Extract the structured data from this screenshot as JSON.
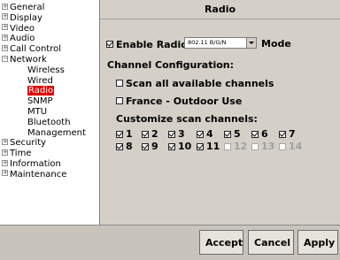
{
  "tree": {
    "items": [
      {
        "label": "General",
        "expander": "+"
      },
      {
        "label": "Display",
        "expander": "+"
      },
      {
        "label": "Video",
        "expander": "+"
      },
      {
        "label": "Audio",
        "expander": "+"
      },
      {
        "label": "Call Control",
        "expander": "+"
      },
      {
        "label": "Network",
        "expander": "−"
      },
      {
        "label": "Wireless"
      },
      {
        "label": "Wired"
      },
      {
        "label": "Radio",
        "selected": true
      },
      {
        "label": "SNMP"
      },
      {
        "label": "MTU"
      },
      {
        "label": "Bluetooth"
      },
      {
        "label": "Management"
      },
      {
        "label": "Security",
        "expander": "+"
      },
      {
        "label": "Time",
        "expander": "+"
      },
      {
        "label": "Information",
        "expander": "+"
      },
      {
        "label": "Maintenance",
        "expander": "+"
      }
    ]
  },
  "panel": {
    "title": "Radio",
    "enable_radio": {
      "label": "Enable Radio",
      "checked": true
    },
    "mode": {
      "selected": "802.11 B/G/N",
      "label": "Mode"
    },
    "channel_config_label": "Channel Configuration:",
    "scan_all": {
      "label": "Scan all available channels",
      "checked": false
    },
    "france": {
      "label": "France - Outdoor Use",
      "checked": false
    },
    "customize_label": "Customize scan channels:",
    "channels": [
      {
        "label": "1",
        "checked": true,
        "enabled": true
      },
      {
        "label": "2",
        "checked": true,
        "enabled": true
      },
      {
        "label": "3",
        "checked": true,
        "enabled": true
      },
      {
        "label": "4",
        "checked": true,
        "enabled": true
      },
      {
        "label": "5",
        "checked": true,
        "enabled": true
      },
      {
        "label": "6",
        "checked": true,
        "enabled": true
      },
      {
        "label": "7",
        "checked": true,
        "enabled": true
      },
      {
        "label": "8",
        "checked": true,
        "enabled": true
      },
      {
        "label": "9",
        "checked": true,
        "enabled": true
      },
      {
        "label": "10",
        "checked": true,
        "enabled": true
      },
      {
        "label": "11",
        "checked": true,
        "enabled": true
      },
      {
        "label": "12",
        "checked": false,
        "enabled": false
      },
      {
        "label": "13",
        "checked": false,
        "enabled": false
      },
      {
        "label": "14",
        "checked": false,
        "enabled": false
      }
    ]
  },
  "buttons": {
    "accept": "Accept",
    "cancel": "Cancel",
    "apply": "Apply"
  },
  "colors": {
    "selected_item": "#e00000",
    "background": "#d4d0c8"
  }
}
